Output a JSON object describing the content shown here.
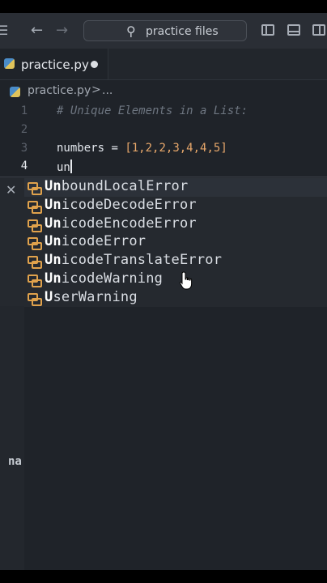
{
  "search": {
    "placeholder": "practice files"
  },
  "tab": {
    "label": "practice.py"
  },
  "breadcrumb": {
    "file": "practice.py",
    "separator": ">",
    "more": "..."
  },
  "editor": {
    "lines": [
      {
        "number": "1",
        "text": "# Unique Elements in a List:"
      },
      {
        "number": "2",
        "text": ""
      },
      {
        "number": "3",
        "var": "numbers",
        "op": " = ",
        "value": "[1,2,2,3,4,4,5]"
      },
      {
        "number": "4",
        "typed": "un"
      }
    ]
  },
  "suggestions": {
    "items": [
      {
        "match": "Un",
        "rest": "boundLocalError"
      },
      {
        "match": "Un",
        "rest": "icodeDecodeError"
      },
      {
        "match": "Un",
        "rest": "icodeEncodeError"
      },
      {
        "match": "Un",
        "rest": "icodeError"
      },
      {
        "match": "Un",
        "rest": "icodeTranslateError"
      },
      {
        "match": "Un",
        "rest": "icodeWarning"
      },
      {
        "match": "U",
        "rest": "serWarning"
      }
    ],
    "icon": "class-icon"
  },
  "panel": {
    "partial_text": "na"
  }
}
